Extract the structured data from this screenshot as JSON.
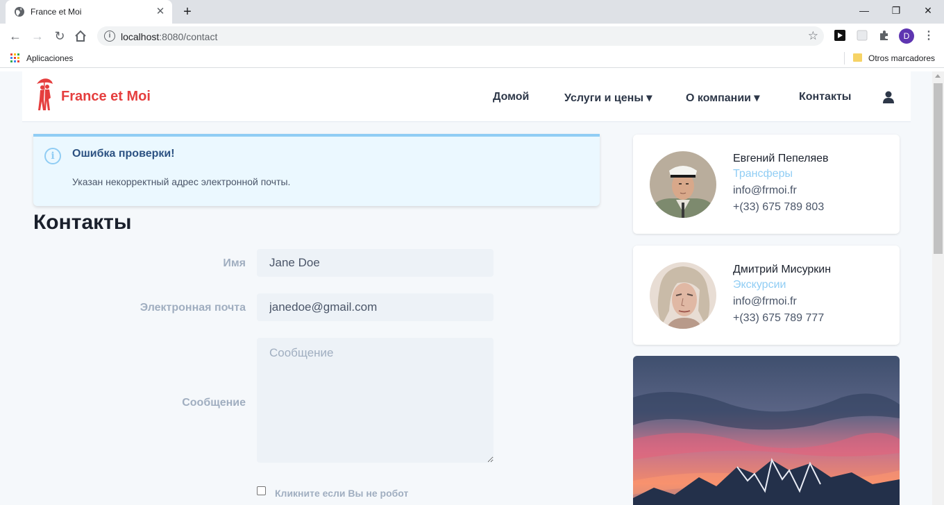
{
  "browser": {
    "tab_title": "France et Moi",
    "tab_close_glyph": "✕",
    "new_tab_glyph": "+",
    "url_host": "localhost",
    "url_rest": ":8080/contact",
    "profile_initial": "D",
    "window_controls": {
      "minimize": "—",
      "restore": "❐",
      "close": "✕"
    },
    "bookmarks": {
      "apps_label": "Aplicaciones",
      "other_label": "Otros marcadores"
    }
  },
  "header": {
    "logo_text": "France et Moi",
    "menu": [
      {
        "label": "Домой"
      },
      {
        "label": "Услуги и цены ▾"
      },
      {
        "label": "О компании  ▾"
      },
      {
        "label": "Контакты"
      }
    ]
  },
  "alert": {
    "title": "Ошибка проверки!",
    "message": "Указан некорректный адрес электронной почты.",
    "icon": "info-icon"
  },
  "page": {
    "title": "Контакты"
  },
  "form": {
    "name_label": "Имя",
    "name_value": "Jane Doe",
    "email_label": "Электронная почта",
    "email_value": "janedoe@gmail.com",
    "message_label": "Сообщение",
    "message_placeholder": "Сообщение",
    "robot_label": "Кликните если Вы не робот"
  },
  "contacts": [
    {
      "name": "Евгений Пепеляев",
      "role": "Трансферы",
      "email": "info@frmoi.fr",
      "phone": "+(33) 675 789 803"
    },
    {
      "name": "Дмитрий Мисуркин",
      "role": "Экскурсии",
      "email": "info@frmoi.fr",
      "phone": "+(33) 675 789 777"
    }
  ],
  "colors": {
    "brand": "#e53e3e",
    "alert_bg": "#ebf8ff",
    "alert_border": "#90cdf4",
    "role_link": "#90cdf4"
  }
}
